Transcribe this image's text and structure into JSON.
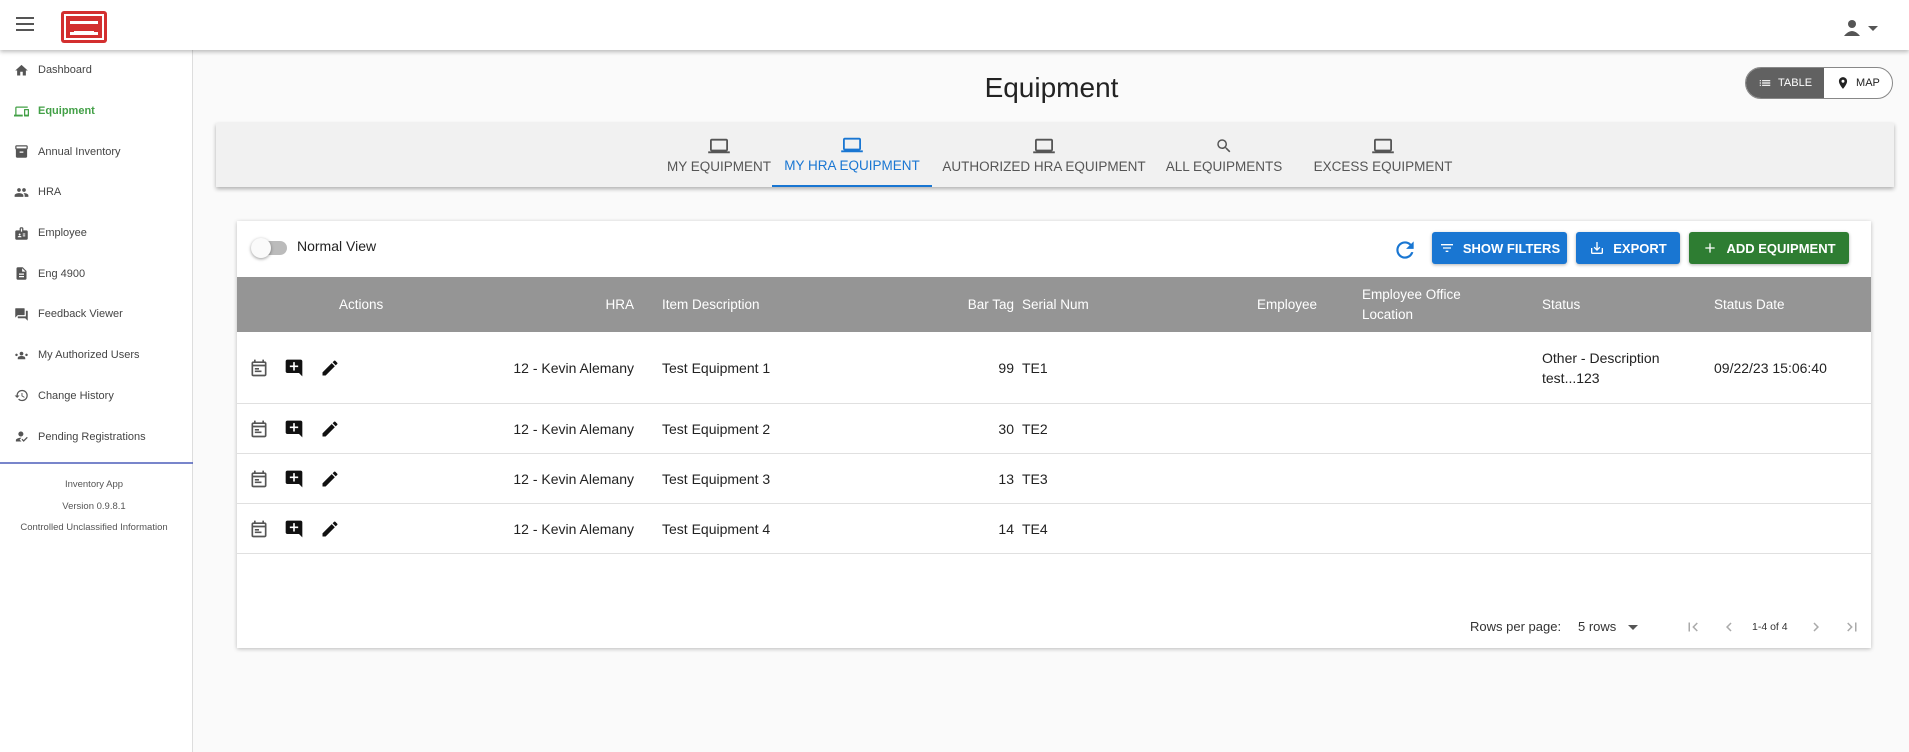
{
  "header": {
    "menu_icon": "menu-icon",
    "logo": "usace-castle-logo",
    "account_icon": "account-icon"
  },
  "sidebar": {
    "items": [
      {
        "label": "Dashboard",
        "icon": "home-icon"
      },
      {
        "label": "Equipment",
        "icon": "devices-icon",
        "active": true
      },
      {
        "label": "Annual Inventory",
        "icon": "inventory-icon"
      },
      {
        "label": "HRA",
        "icon": "people-icon"
      },
      {
        "label": "Employee",
        "icon": "badge-icon"
      },
      {
        "label": "Eng 4900",
        "icon": "document-icon"
      },
      {
        "label": "Feedback Viewer",
        "icon": "feedback-icon"
      },
      {
        "label": "My Authorized Users",
        "icon": "group-icon"
      },
      {
        "label": "Change History",
        "icon": "history-icon"
      },
      {
        "label": "Pending Registrations",
        "icon": "how-to-reg-icon"
      }
    ],
    "app_name": "Inventory App",
    "version": "Version 0.9.8.1",
    "classification": "Controlled Unclassified Information"
  },
  "page": {
    "title": "Equipment",
    "view_toggle": {
      "table": "TABLE",
      "map": "MAP",
      "selected": "TABLE"
    }
  },
  "tabs": [
    {
      "label": "MY EQUIPMENT",
      "icon": "laptop-icon"
    },
    {
      "label": "MY HRA EQUIPMENT",
      "icon": "laptop-icon",
      "active": true
    },
    {
      "label": "AUTHORIZED HRA EQUIPMENT",
      "icon": "laptop-icon"
    },
    {
      "label": "ALL EQUIPMENTS",
      "icon": "search-icon"
    },
    {
      "label": "EXCESS EQUIPMENT",
      "icon": "laptop-icon"
    }
  ],
  "toolbar": {
    "view_label": "Normal View",
    "show_filters": "SHOW FILTERS",
    "export": "EXPORT",
    "add_equipment": "ADD EQUIPMENT"
  },
  "table": {
    "columns": {
      "actions": "Actions",
      "hra": "HRA",
      "item_description": "Item Description",
      "bar_tag": "Bar Tag",
      "serial_num": "Serial Num",
      "employee": "Employee",
      "employee_office_location": "Employee Office Location",
      "status": "Status",
      "status_date": "Status Date"
    },
    "rows": [
      {
        "hra": "12 - Kevin Alemany",
        "item_description": "Test Equipment 1",
        "bar_tag": "99",
        "serial_num": "TE1",
        "employee": "",
        "office": "",
        "status": "Other - Description test...123",
        "status_date": "09/22/23 15:06:40"
      },
      {
        "hra": "12 - Kevin Alemany",
        "item_description": "Test Equipment 2",
        "bar_tag": "30",
        "serial_num": "TE2",
        "employee": "",
        "office": "",
        "status": "",
        "status_date": ""
      },
      {
        "hra": "12 - Kevin Alemany",
        "item_description": "Test Equipment 3",
        "bar_tag": "13",
        "serial_num": "TE3",
        "employee": "",
        "office": "",
        "status": "",
        "status_date": ""
      },
      {
        "hra": "12 - Kevin Alemany",
        "item_description": "Test Equipment 4",
        "bar_tag": "14",
        "serial_num": "TE4",
        "employee": "",
        "office": "",
        "status": "",
        "status_date": ""
      }
    ],
    "row_actions": [
      "calendar-icon",
      "add-comment-icon",
      "edit-icon"
    ]
  },
  "pagination": {
    "rows_per_page_label": "Rows per page:",
    "rows_per_page_value": "5 rows",
    "range": "1-4 of 4"
  },
  "colors": {
    "primary": "#1976d2",
    "success": "#2e7d32",
    "active_nav": "#43a047",
    "header_bg": "#959595",
    "logo_red": "#d32f2f"
  }
}
